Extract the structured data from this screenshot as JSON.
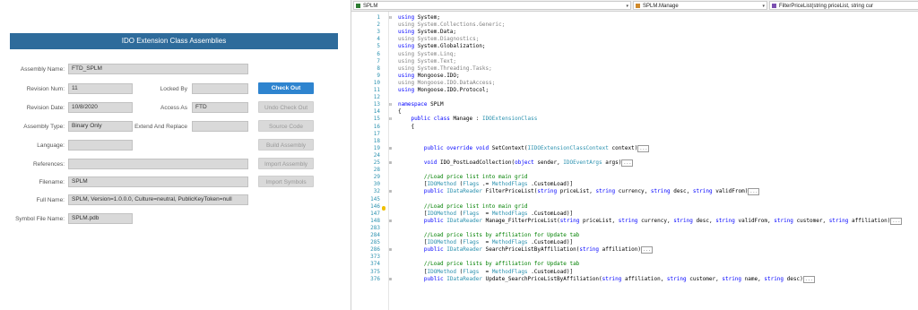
{
  "form": {
    "header": "IDO Extension Class Assemblies",
    "assembly_name": {
      "label": "Assembly Name:",
      "value": "FTD_SPLM"
    },
    "revision_num": {
      "label": "Revision Num:",
      "value": "11"
    },
    "locked_by": {
      "label": "Locked By",
      "value": ""
    },
    "revision_date": {
      "label": "Revision Date:",
      "value": "10/8/2020"
    },
    "access_as": {
      "label": "Access As",
      "value": "FTD"
    },
    "assembly_type": {
      "label": "Assembly Type:",
      "value": "Binary Only"
    },
    "extend_and_replace": {
      "label": "Extend And Replace",
      "value": ""
    },
    "language": {
      "label": "Language:",
      "value": ""
    },
    "references": {
      "label": "References:",
      "value": ""
    },
    "filename": {
      "label": "Filename:",
      "value": "SPLM"
    },
    "full_name": {
      "label": "Full Name:",
      "value": "SPLM, Version=1.0.0.0, Culture=neutral, PublicKeyToken=null"
    },
    "symbol_file_name": {
      "label": "Symbol File Name:",
      "value": "SPLM.pdb"
    },
    "buttons": {
      "check_out": "Check Out",
      "undo_check_out": "Undo Check Out",
      "source_code": "Source Code",
      "build_assembly": "Build Assembly",
      "import_assembly": "Import Assembly",
      "import_symbols": "Import Symbols"
    }
  },
  "editor": {
    "nav": {
      "project": "SPLM",
      "class": "SPLM.Manage",
      "member": "FilterPriceList(string priceList, string cur"
    },
    "lines": [
      {
        "n": "1",
        "fold": "⊟",
        "parts": [
          [
            "kw",
            "using"
          ],
          [
            "",
            "System;"
          ]
        ]
      },
      {
        "n": "2",
        "fold": "",
        "parts": [
          [
            "gray",
            "using System.Collections.Generic;"
          ]
        ]
      },
      {
        "n": "3",
        "fold": "",
        "parts": [
          [
            "kw",
            "using"
          ],
          [
            "",
            "System.Data;"
          ]
        ]
      },
      {
        "n": "4",
        "fold": "",
        "parts": [
          [
            "gray",
            "using System.Diagnostics;"
          ]
        ]
      },
      {
        "n": "5",
        "fold": "",
        "parts": [
          [
            "kw",
            "using"
          ],
          [
            "",
            "System.Globalization;"
          ]
        ]
      },
      {
        "n": "6",
        "fold": "",
        "parts": [
          [
            "gray",
            "using System.Linq;"
          ]
        ]
      },
      {
        "n": "7",
        "fold": "",
        "parts": [
          [
            "gray",
            "using System.Text;"
          ]
        ]
      },
      {
        "n": "8",
        "fold": "",
        "parts": [
          [
            "gray",
            "using System.Threading.Tasks;"
          ]
        ]
      },
      {
        "n": "9",
        "fold": "",
        "parts": [
          [
            "kw",
            "using"
          ],
          [
            "",
            "Mongoose.IDO;"
          ]
        ]
      },
      {
        "n": "10",
        "fold": "",
        "parts": [
          [
            "gray",
            "using Mongoose.IDO.DataAccess;"
          ]
        ]
      },
      {
        "n": "11",
        "fold": "",
        "parts": [
          [
            "kw",
            "using"
          ],
          [
            "",
            "Mongoose.IDO.Protocol;"
          ]
        ]
      },
      {
        "n": "12",
        "fold": "",
        "parts": []
      },
      {
        "n": "13",
        "fold": "⊟",
        "parts": [
          [
            "kw",
            "namespace"
          ],
          [
            "",
            "SPLM"
          ]
        ]
      },
      {
        "n": "14",
        "fold": "",
        "parts": [
          [
            "",
            "{"
          ]
        ]
      },
      {
        "n": "15",
        "fold": "⊟",
        "parts": [
          [
            "",
            "    "
          ],
          [
            "kw",
            "public class"
          ],
          [
            "",
            "Manage : "
          ],
          [
            "ty",
            "IDOExtensionClass"
          ]
        ]
      },
      {
        "n": "16",
        "fold": "",
        "parts": [
          [
            "",
            "    {"
          ]
        ]
      },
      {
        "n": "17",
        "fold": "",
        "parts": []
      },
      {
        "n": "18",
        "fold": "",
        "parts": []
      },
      {
        "n": "19",
        "fold": "⊞",
        "parts": [
          [
            "",
            "        "
          ],
          [
            "kw",
            "public override void"
          ],
          [
            "",
            "SetContext("
          ],
          [
            "ty",
            "IIDOExtensionClassContext"
          ],
          [
            "",
            "context)"
          ],
          [
            "collapsed",
            "..."
          ]
        ]
      },
      {
        "n": "24",
        "fold": "",
        "parts": []
      },
      {
        "n": "25",
        "fold": "⊞",
        "parts": [
          [
            "",
            "        "
          ],
          [
            "kw",
            "void"
          ],
          [
            "",
            "IDO_PostLoadCollection("
          ],
          [
            "kw",
            "object"
          ],
          [
            "",
            "sender, "
          ],
          [
            "ty",
            "IDOEventArgs"
          ],
          [
            "",
            "args)"
          ],
          [
            "collapsed",
            "..."
          ]
        ]
      },
      {
        "n": "28",
        "fold": "",
        "parts": []
      },
      {
        "n": "29",
        "fold": "",
        "parts": [
          [
            "",
            "        "
          ],
          [
            "cm",
            "//Load price list into main grid"
          ]
        ]
      },
      {
        "n": "30",
        "fold": "",
        "parts": [
          [
            "",
            "        ["
          ],
          [
            "ty",
            "IDOMethod"
          ],
          [
            "",
            "("
          ],
          [
            "ty",
            "Flags"
          ],
          [
            "",
            ".= "
          ],
          [
            "ty",
            "MethodFlags"
          ],
          [
            "",
            ".CustomLoad)]"
          ]
        ]
      },
      {
        "n": "32",
        "fold": "⊞",
        "parts": [
          [
            "",
            "        "
          ],
          [
            "kw",
            "public"
          ],
          [
            "ty",
            "IDataReader"
          ],
          [
            "",
            "FilterPriceList("
          ],
          [
            "kw",
            "string"
          ],
          [
            "",
            "priceList, "
          ],
          [
            "kw",
            "string"
          ],
          [
            "",
            "currency, "
          ],
          [
            "kw",
            "string"
          ],
          [
            "",
            "desc, "
          ],
          [
            "kw",
            "string"
          ],
          [
            "",
            "validFrom)"
          ],
          [
            "collapsed",
            "..."
          ]
        ]
      },
      {
        "n": "145",
        "fold": "",
        "parts": []
      },
      {
        "n": "146",
        "fold": "",
        "parts": [
          [
            "",
            "        "
          ],
          [
            "cm",
            "//Load price list into main grid"
          ]
        ]
      },
      {
        "n": "147",
        "fold": "",
        "parts": [
          [
            "",
            "        ["
          ],
          [
            "ty",
            "IDOMethod"
          ],
          [
            "",
            "("
          ],
          [
            "ty",
            "Flags"
          ],
          [
            "",
            " = "
          ],
          [
            "ty",
            "MethodFlags"
          ],
          [
            "",
            ".CustomLoad)]"
          ]
        ]
      },
      {
        "n": "148",
        "fold": "⊞",
        "parts": [
          [
            "",
            "        "
          ],
          [
            "kw",
            "public"
          ],
          [
            "ty",
            "IDataReader"
          ],
          [
            "",
            "Manage_FilterPriceList("
          ],
          [
            "kw",
            "string"
          ],
          [
            "",
            "priceList, "
          ],
          [
            "kw",
            "string"
          ],
          [
            "",
            "currency, "
          ],
          [
            "kw",
            "string"
          ],
          [
            "",
            "desc, "
          ],
          [
            "kw",
            "string"
          ],
          [
            "",
            "validFrom, "
          ],
          [
            "kw",
            "string"
          ],
          [
            "",
            "customer, "
          ],
          [
            "kw",
            "string"
          ],
          [
            "",
            "affiliation)"
          ],
          [
            "collapsed",
            "..."
          ]
        ]
      },
      {
        "n": "283",
        "fold": "",
        "parts": []
      },
      {
        "n": "284",
        "fold": "",
        "parts": [
          [
            "",
            "        "
          ],
          [
            "cm",
            "//Load price lists by affiliation for Update tab"
          ]
        ]
      },
      {
        "n": "285",
        "fold": "",
        "parts": [
          [
            "",
            "        ["
          ],
          [
            "ty",
            "IDOMethod"
          ],
          [
            "",
            "("
          ],
          [
            "ty",
            "Flags"
          ],
          [
            "",
            " = "
          ],
          [
            "ty",
            "MethodFlags"
          ],
          [
            "",
            ".CustomLoad)]"
          ]
        ]
      },
      {
        "n": "286",
        "fold": "⊞",
        "parts": [
          [
            "",
            "        "
          ],
          [
            "kw",
            "public"
          ],
          [
            "ty",
            "IDataReader"
          ],
          [
            "",
            "SearchPriceListByAffiliation("
          ],
          [
            "kw",
            "string"
          ],
          [
            "",
            "affiliation)"
          ],
          [
            "collapsed",
            "..."
          ]
        ]
      },
      {
        "n": "373",
        "fold": "",
        "parts": []
      },
      {
        "n": "374",
        "fold": "",
        "parts": [
          [
            "",
            "        "
          ],
          [
            "cm",
            "//Load price lists by affiliation for Update tab"
          ]
        ]
      },
      {
        "n": "375",
        "fold": "",
        "parts": [
          [
            "",
            "        ["
          ],
          [
            "ty",
            "IDOMethod"
          ],
          [
            "",
            "("
          ],
          [
            "ty",
            "Flags"
          ],
          [
            "",
            " = "
          ],
          [
            "ty",
            "MethodFlags"
          ],
          [
            "",
            ".CustomLoad)]"
          ]
        ]
      },
      {
        "n": "376",
        "fold": "⊞",
        "parts": [
          [
            "",
            "        "
          ],
          [
            "kw",
            "public"
          ],
          [
            "ty",
            "IDataReader"
          ],
          [
            "",
            "Update_SearchPriceListByAffiliation("
          ],
          [
            "kw",
            "string"
          ],
          [
            "",
            "affiliation, "
          ],
          [
            "kw",
            "string"
          ],
          [
            "",
            "customer, "
          ],
          [
            "kw",
            "string"
          ],
          [
            "",
            "name, "
          ],
          [
            "kw",
            "string"
          ],
          [
            "",
            "desc)"
          ],
          [
            "collapsed",
            "..."
          ]
        ]
      }
    ]
  },
  "colors": {
    "header_bg": "#2e6b9b",
    "primary_button": "#2e84cf",
    "keyword": "#0000ff",
    "type": "#2b91af",
    "comment": "#008000"
  }
}
